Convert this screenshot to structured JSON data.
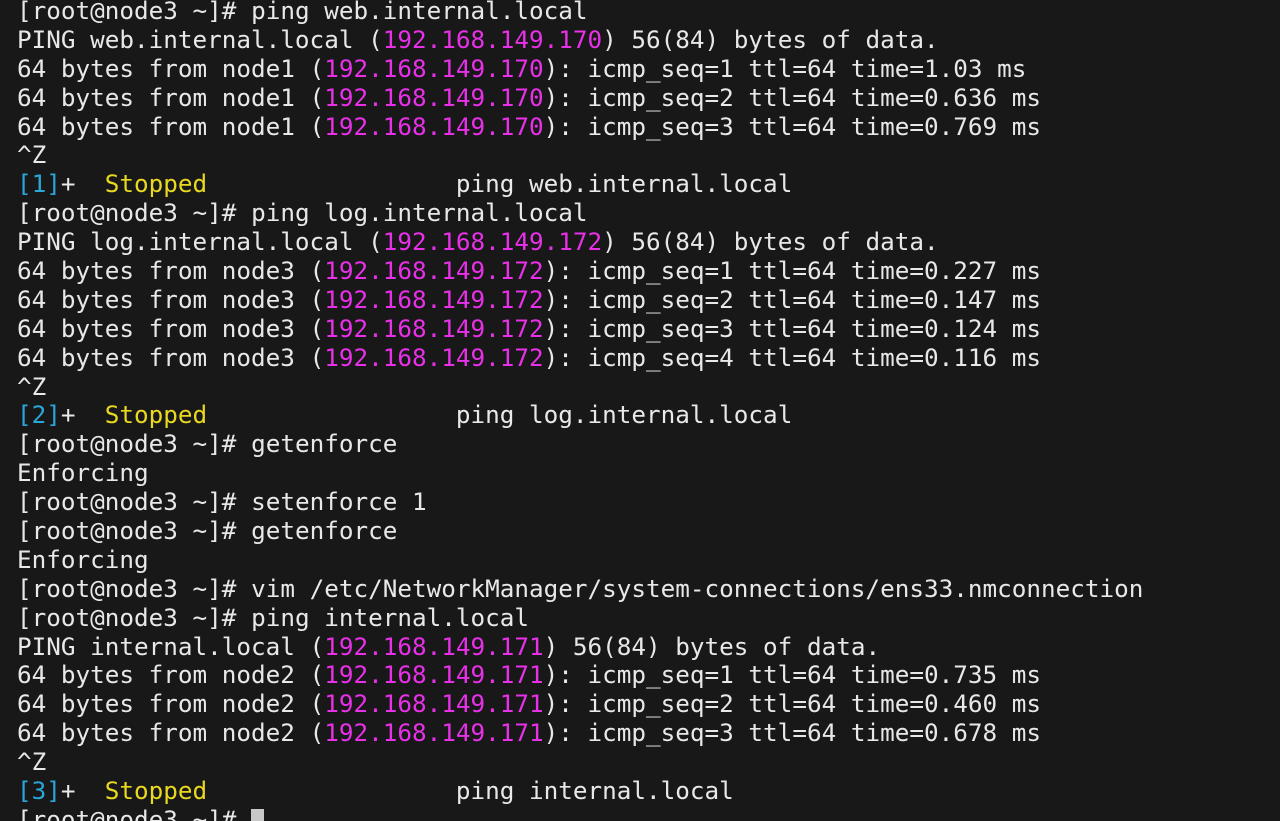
{
  "terminal": {
    "prompt": "[root@node3 ~]# ",
    "lines": [
      {
        "type": "cmd",
        "text": "ping web.internal.local"
      },
      {
        "type": "ping_header",
        "host": "web.internal.local",
        "ip": "192.168.149.170",
        "tail": " 56(84) bytes of data."
      },
      {
        "type": "ping_reply",
        "node": "node1",
        "ip": "192.168.149.170",
        "rest": ": icmp_seq=1 ttl=64 time=1.03 ms"
      },
      {
        "type": "ping_reply",
        "node": "node1",
        "ip": "192.168.149.170",
        "rest": ": icmp_seq=2 ttl=64 time=0.636 ms"
      },
      {
        "type": "ping_reply",
        "node": "node1",
        "ip": "192.168.149.170",
        "rest": ": icmp_seq=3 ttl=64 time=0.769 ms"
      },
      {
        "type": "plain",
        "text": "^Z"
      },
      {
        "type": "job",
        "id": "[1]",
        "status": "Stopped",
        "cmd": "ping web.internal.local"
      },
      {
        "type": "cmd",
        "text": "ping log.internal.local"
      },
      {
        "type": "ping_header",
        "host": "log.internal.local",
        "ip": "192.168.149.172",
        "tail": " 56(84) bytes of data."
      },
      {
        "type": "ping_reply",
        "node": "node3",
        "ip": "192.168.149.172",
        "rest": ": icmp_seq=1 ttl=64 time=0.227 ms"
      },
      {
        "type": "ping_reply",
        "node": "node3",
        "ip": "192.168.149.172",
        "rest": ": icmp_seq=2 ttl=64 time=0.147 ms"
      },
      {
        "type": "ping_reply",
        "node": "node3",
        "ip": "192.168.149.172",
        "rest": ": icmp_seq=3 ttl=64 time=0.124 ms"
      },
      {
        "type": "ping_reply",
        "node": "node3",
        "ip": "192.168.149.172",
        "rest": ": icmp_seq=4 ttl=64 time=0.116 ms"
      },
      {
        "type": "plain",
        "text": "^Z"
      },
      {
        "type": "job",
        "id": "[2]",
        "status": "Stopped",
        "cmd": "ping log.internal.local"
      },
      {
        "type": "cmd",
        "text": "getenforce"
      },
      {
        "type": "plain",
        "text": "Enforcing"
      },
      {
        "type": "cmd",
        "text": "setenforce 1"
      },
      {
        "type": "cmd",
        "text": "getenforce"
      },
      {
        "type": "plain",
        "text": "Enforcing"
      },
      {
        "type": "cmd",
        "text": "vim /etc/NetworkManager/system-connections/ens33.nmconnection"
      },
      {
        "type": "cmd",
        "text": "ping internal.local"
      },
      {
        "type": "ping_header",
        "host": "internal.local",
        "ip": "192.168.149.171",
        "tail": " 56(84) bytes of data."
      },
      {
        "type": "ping_reply",
        "node": "node2",
        "ip": "192.168.149.171",
        "rest": ": icmp_seq=1 ttl=64 time=0.735 ms"
      },
      {
        "type": "ping_reply",
        "node": "node2",
        "ip": "192.168.149.171",
        "rest": ": icmp_seq=2 ttl=64 time=0.460 ms"
      },
      {
        "type": "ping_reply",
        "node": "node2",
        "ip": "192.168.149.171",
        "rest": ": icmp_seq=3 ttl=64 time=0.678 ms"
      },
      {
        "type": "plain",
        "text": "^Z"
      },
      {
        "type": "job",
        "id": "[3]",
        "status": "Stopped",
        "cmd": "ping internal.local"
      },
      {
        "type": "input",
        "text": ""
      }
    ]
  },
  "colors": {
    "background": "#181818",
    "text": "#e8e8e8",
    "ip": "#e830e8",
    "job_id": "#2aa6d8",
    "stopped": "#e8d820"
  }
}
